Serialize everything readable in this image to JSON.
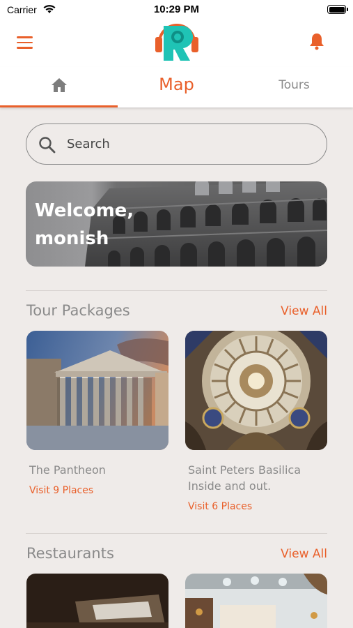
{
  "status_bar": {
    "carrier": "Carrier",
    "time": "10:29 PM"
  },
  "header": {
    "logo_name": "logo"
  },
  "tabs": {
    "home_icon": "home-icon",
    "map_label": "Map",
    "tours_label": "Tours"
  },
  "search": {
    "placeholder": "Search"
  },
  "welcome": {
    "line1": "Welcome,",
    "line2": "monish"
  },
  "tour_packages": {
    "title": "Tour Packages",
    "view_all": "View All",
    "items": [
      {
        "title": "The Pantheon",
        "visit": "Visit 9  Places"
      },
      {
        "title": "Saint Peters Basilica Inside and out.",
        "visit": "Visit 6  Places"
      }
    ]
  },
  "restaurants": {
    "title": "Restaurants",
    "view_all": "View All"
  },
  "colors": {
    "accent": "#e9602b",
    "background": "#efebe9",
    "muted": "#8a8a8a",
    "logo_teal": "#1fc3b5"
  }
}
